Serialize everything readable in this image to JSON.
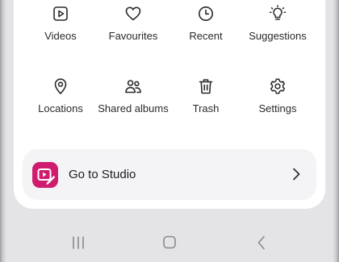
{
  "menu": {
    "items": [
      {
        "label": "Videos",
        "icon": "video-play-icon"
      },
      {
        "label": "Favourites",
        "icon": "heart-icon"
      },
      {
        "label": "Recent",
        "icon": "clock-icon"
      },
      {
        "label": "Suggestions",
        "icon": "lightbulb-icon"
      },
      {
        "label": "Locations",
        "icon": "map-pin-icon"
      },
      {
        "label": "Shared albums",
        "icon": "people-icon"
      },
      {
        "label": "Trash",
        "icon": "trash-icon"
      },
      {
        "label": "Settings",
        "icon": "gear-icon"
      }
    ]
  },
  "studio": {
    "label": "Go to Studio",
    "icon": "studio-logo-icon",
    "accent_color": "#d01c6e"
  },
  "navbar": {
    "recents_icon": "recent-apps-icon",
    "home_icon": "home-icon",
    "back_icon": "back-icon"
  }
}
